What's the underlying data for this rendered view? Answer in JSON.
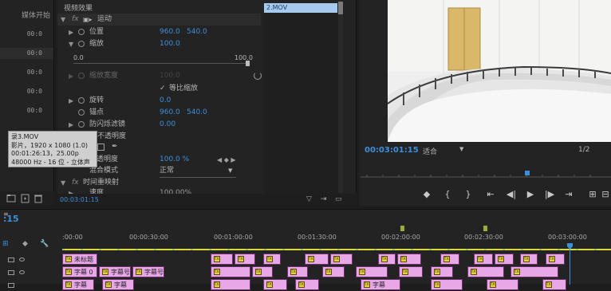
{
  "colors": {
    "accent": "#3d8fdc",
    "clip_pink": "#e8a8e8",
    "clip_bar": "#a6c9ee",
    "playhead": "#3d8fdc"
  },
  "left_panel": {
    "column_header": "媒体开始",
    "timecodes": [
      "00:0",
      "00:0",
      "00:0",
      "00:0",
      "00:0"
    ]
  },
  "effect_controls": {
    "header": "视频效果",
    "clip_name": "2.MOV",
    "motion": {
      "label": "运动",
      "position": {
        "label": "位置",
        "x": "960.0",
        "y": "540.0"
      },
      "scale": {
        "label": "缩放",
        "value": "100.0",
        "slider_min": "0.0",
        "slider_max": "100.0"
      },
      "scale_width": {
        "label": "缩放宽度",
        "value": "100.0"
      },
      "uniform_scale": {
        "label": "等比缩放",
        "checked": true
      },
      "rotation": {
        "label": "旋转",
        "value": "0.0"
      },
      "anchor": {
        "label": "锚点",
        "x": "960.0",
        "y": "540.0"
      },
      "anti_flicker": {
        "label": "防闪烁滤镜",
        "value": "0.00"
      }
    },
    "opacity": {
      "label": "不透明度",
      "value": "100.0 %",
      "blend_label": "混合模式",
      "blend_value": "正常"
    },
    "time_remap": {
      "label": "时间重映射",
      "speed_label": "速度",
      "speed_value": "100.00%"
    },
    "footer_time": "00:03:01:15"
  },
  "tooltip": {
    "lines": [
      "录3.MOV",
      "影片，1920 x 1080 (1.0)",
      "00:01:26:13，25.00p",
      "48000 Hz - 16 位 - 立体声"
    ]
  },
  "program_monitor": {
    "timecode": "00:03:01:15",
    "fit_label": "适合",
    "resolution": "1/2"
  },
  "timeline": {
    "current_time": ":15",
    "ruler_labels": [
      ":00:00",
      "00:00:30:00",
      "00:01:00:00",
      "00:01:30:00",
      "00:02:00:00",
      "00:02:30:00",
      "00:03:00:00"
    ],
    "clip_labels": {
      "c1": "字幕",
      "c2": "字幕",
      "c3": "字幕",
      "c4": "字幕",
      "c5": "字幕",
      "c6": "字幕",
      "c7": "字幕",
      "c8": "字幕",
      "c9": "字幕",
      "c10": "字幕"
    },
    "clip_texts": {
      "top_left": "未标题",
      "mid1": "字幕 0",
      "mid2": "字幕号",
      "mid3": "字幕号",
      "bot1": "字幕",
      "bot2": "字幕",
      "bot3": "字幕"
    }
  }
}
